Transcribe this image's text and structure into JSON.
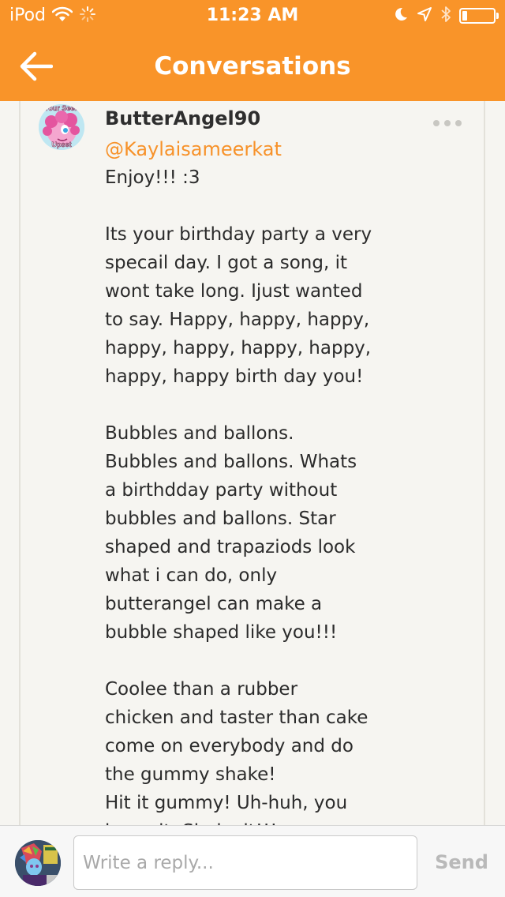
{
  "status_bar": {
    "carrier": "iPod",
    "time": "11:23 AM",
    "battery_level": 0.15
  },
  "nav": {
    "title": "Conversations"
  },
  "message": {
    "author": "ButterAngel90",
    "mention": "@Kaylaisameerkat",
    "avatar_caption_top": "Your Seen",
    "avatar_caption_bottom": "Upset",
    "lines": [
      "Enjoy!!! :3",
      "",
      "Its your birthday party a very",
      "specail day. I got a song, it",
      "wont take long. Ijust wanted",
      "to say. Happy, happy, happy,",
      "happy, happy, happy, happy,",
      "happy, happy birth day you!",
      "",
      "Bubbles and ballons.",
      "Bubbles and ballons. Whats",
      "a birthdday party without",
      "bubbles and ballons. Star",
      "shaped and trapaziods look",
      "what i can do, only",
      "butterangel can make a",
      "bubble shaped like you!!!",
      "",
      "Coolee than a rubber",
      "chicken and taster than cake",
      "come on everybody and do",
      "the gummy shake!",
      "Hit it gummy! Uh-huh, you",
      "know it. Shake it!!!"
    ]
  },
  "reply": {
    "placeholder": "Write a reply...",
    "send_label": "Send"
  },
  "colors": {
    "brand_orange": "#f99429",
    "mention": "#f7922a",
    "send_disabled": "#b9b9b9"
  }
}
